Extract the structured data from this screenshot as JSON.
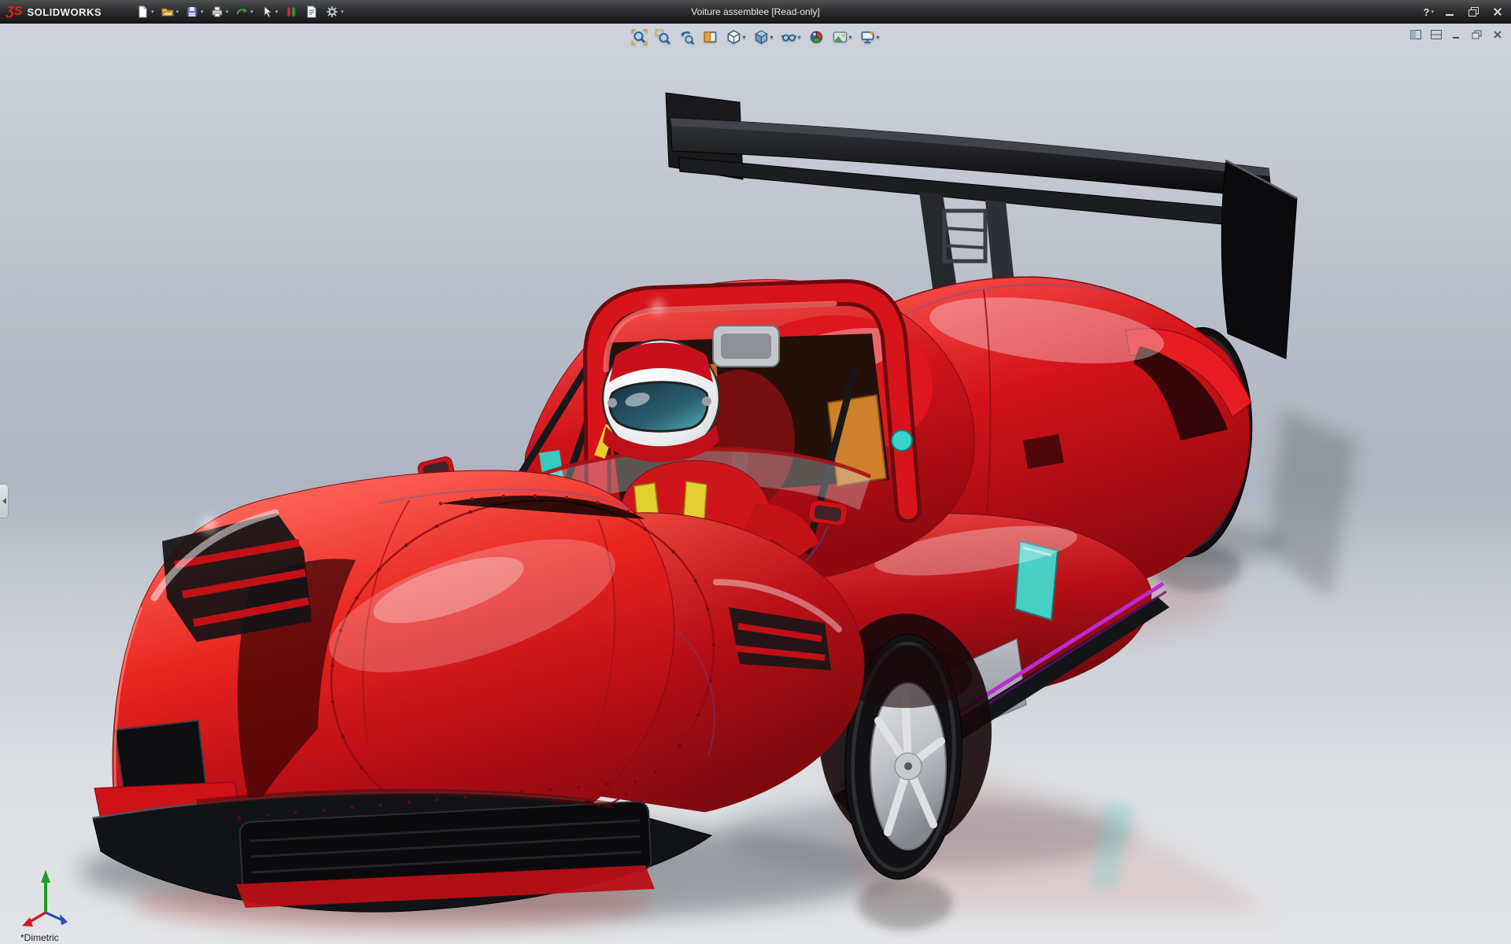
{
  "app": {
    "brand": "SOLIDWORKS",
    "logo_glyph": "ƷS",
    "title": "Voiture assemblee [Read-only]"
  },
  "title_bar": {
    "help_label": "?",
    "menu_icons": [
      {
        "name": "new-document-icon",
        "dropdown": true
      },
      {
        "name": "open-document-icon",
        "dropdown": true
      },
      {
        "name": "save-icon",
        "dropdown": true
      },
      {
        "name": "print-icon",
        "dropdown": true
      },
      {
        "name": "undo-icon",
        "dropdown": true
      },
      {
        "name": "select-cursor-icon",
        "dropdown": true
      },
      {
        "name": "rebuild-icon",
        "dropdown": false
      },
      {
        "name": "file-properties-icon",
        "dropdown": false
      },
      {
        "name": "options-gear-icon",
        "dropdown": true
      }
    ],
    "window_controls": [
      {
        "name": "minimize-button"
      },
      {
        "name": "restore-button"
      },
      {
        "name": "close-button"
      }
    ]
  },
  "heads_up_toolbar": {
    "icons": [
      {
        "name": "zoom-to-fit-icon",
        "dropdown": false
      },
      {
        "name": "zoom-to-area-icon",
        "dropdown": false
      },
      {
        "name": "previous-view-icon",
        "dropdown": false
      },
      {
        "name": "section-view-icon",
        "dropdown": false
      },
      {
        "name": "view-orientation-icon",
        "dropdown": true
      },
      {
        "name": "display-style-icon",
        "dropdown": true
      },
      {
        "name": "hide-show-items-icon",
        "dropdown": true
      },
      {
        "name": "edit-appearance-icon",
        "dropdown": false
      },
      {
        "name": "apply-scene-icon",
        "dropdown": true
      },
      {
        "name": "view-settings-icon",
        "dropdown": true
      }
    ]
  },
  "viewport": {
    "orientation_label": "*Dimetric",
    "doc_window_controls": [
      {
        "name": "window-split-icon"
      },
      {
        "name": "window-pane-icon"
      },
      {
        "name": "doc-minimize-icon"
      },
      {
        "name": "doc-restore-icon"
      },
      {
        "name": "doc-close-icon"
      }
    ],
    "model": {
      "description": "Red open-cockpit Le Mans prototype race car with helmeted driver, black rear wing, silver wheels, on reflective floor",
      "body_color": "#d4131a",
      "wing_color": "#101012",
      "window_accent": "#45d8ce",
      "sill_accent": "#bb2bd4",
      "rim_color": "#caccd2",
      "harness_color": "#e3cf2e",
      "cockpit_pad_color": "#d8872c"
    },
    "triad_axis_colors": {
      "x": "#cc2020",
      "y": "#1e9e1e",
      "z": "#2a46c8"
    }
  },
  "colors": {
    "titlebar_bg": "#2a2b2d",
    "titlebar_text": "#e6e6e6",
    "viewport_top": "#ced2da",
    "viewport_mid": "#aeb5c1",
    "viewport_floor": "#e2e4e7"
  }
}
